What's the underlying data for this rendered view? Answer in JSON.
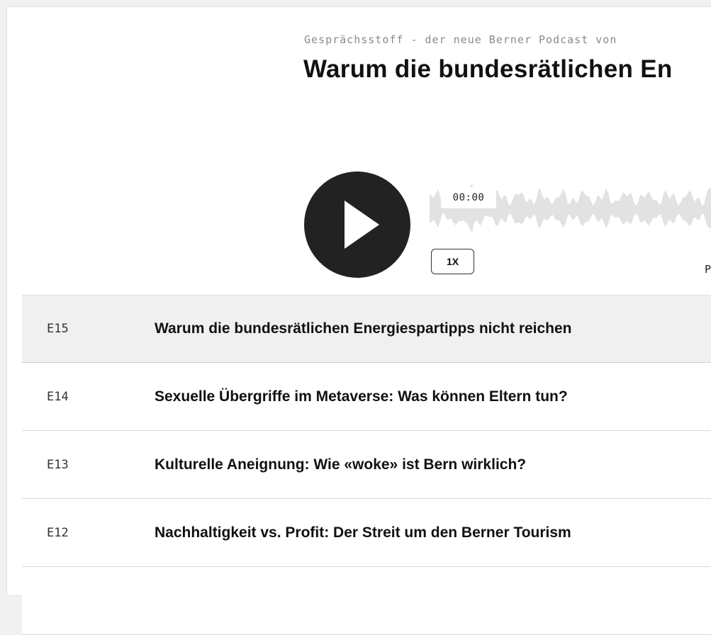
{
  "player": {
    "subtitle": "Gesprächsstoff - der neue Berner Podcast von",
    "title": "Warum die bundesrätlichen En",
    "time": "00:00",
    "speed": "1X",
    "cut_label": "P",
    "play_icon": "play-icon"
  },
  "episodes": [
    {
      "number": "E15",
      "title": "Warum die bundesrätlichen Energiespartipps nicht reichen"
    },
    {
      "number": "E14",
      "title": "Sexuelle Übergriffe im Metaverse: Was können Eltern tun?"
    },
    {
      "number": "E13",
      "title": "Kulturelle Aneignung: Wie «woke» ist Bern wirklich?"
    },
    {
      "number": "E12",
      "title": "Nachhaltigkeit vs. Profit: Der Streit um den Berner Tourism"
    }
  ],
  "colors": {
    "background": "#f1f1f1",
    "card": "#ffffff",
    "play_button": "#222222",
    "waveform": "#e2e2e2",
    "active_row": "#f0f0f0"
  }
}
